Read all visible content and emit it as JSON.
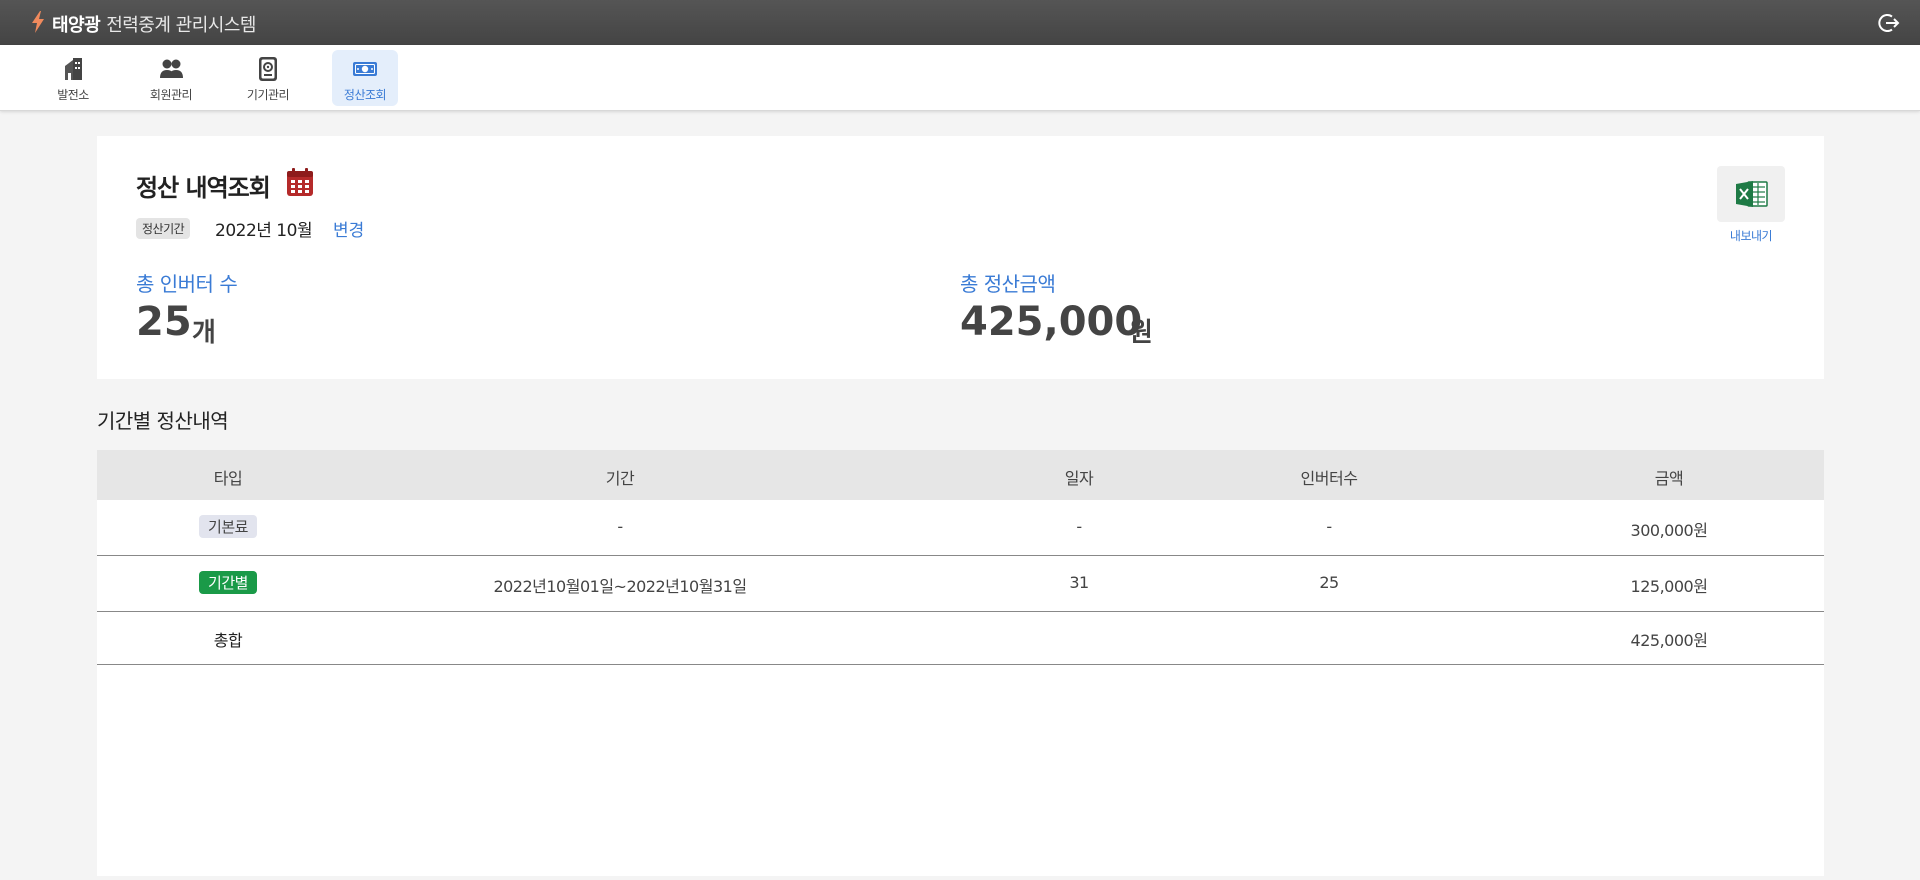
{
  "app": {
    "title_bold": "태양광",
    "title_rest": "전력중계 관리시스템"
  },
  "nav": {
    "items": [
      {
        "label": "발전소",
        "icon": "building-icon"
      },
      {
        "label": "회원관리",
        "icon": "users-icon"
      },
      {
        "label": "기기관리",
        "icon": "device-icon"
      },
      {
        "label": "정산조회",
        "icon": "money-icon",
        "active": true
      }
    ]
  },
  "summary": {
    "title": "정산 내역조회",
    "period_badge": "정산기간",
    "period_value": "2022년 10월",
    "change_link": "변경",
    "export_label": "내보내기",
    "inverter_label": "총 인버터 수",
    "inverter_value": "25",
    "inverter_unit": "개",
    "amount_label": "총 정산금액",
    "amount_value": "425,000",
    "amount_unit": "원"
  },
  "table": {
    "section_title": "기간별 정산내역",
    "headers": [
      "타입",
      "기간",
      "일자",
      "인버터수",
      "금액"
    ],
    "rows": [
      {
        "type": "기본료",
        "period": "-",
        "days": "-",
        "inverters": "-",
        "amount": "300,000원"
      },
      {
        "type": "기간별",
        "period": "2022년10월01일~2022년10월31일",
        "days": "31",
        "inverters": "25",
        "amount": "125,000원"
      }
    ],
    "total": {
      "label": "총합",
      "amount": "425,000원"
    }
  },
  "colors": {
    "accent": "#3a7bd5",
    "topbar": "#4a4a4a",
    "period_tag": "#1a9a48",
    "bolt": "#f08a5d"
  }
}
